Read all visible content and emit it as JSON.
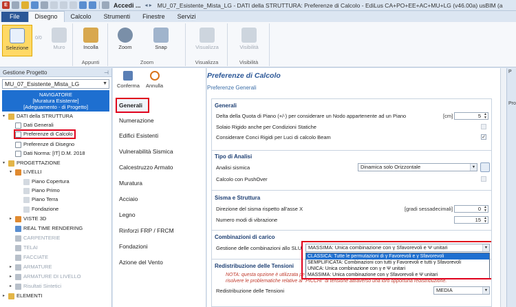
{
  "titlebar": {
    "accedi": "Accedi ...",
    "title": "MU_07_Esistente_Mista_LG  -  DATI della STRUTTURA: Preferenze di Calcolo - EdiLus CA+PO+EE+AC+MU+LG (v46.00a) usBIM (a"
  },
  "ribbon": {
    "tabs": [
      "File",
      "Disegno",
      "Calcolo",
      "Strumenti",
      "Finestre",
      "Servizi"
    ],
    "groups": {
      "selezione": "Selezione",
      "muro": "Muro",
      "counter": "0/0",
      "incolla": "Incolla",
      "appunti": "Appunti",
      "zoom1": "Zoom",
      "zoom2": "Zoom",
      "snap": "Snap",
      "visualizza1": "Visualizza",
      "visualizza2": "Visualizza",
      "visibilita1": "Visibilità",
      "visibilita2": "Visibilità"
    }
  },
  "project": {
    "header": "Gestione Progetto",
    "selected": "MU_07_Esistente_Mista_LG",
    "navigator": [
      "NAVIGATORE",
      "[Muratura Esistente]",
      "[Adeguamento - di Progetto]"
    ],
    "tree": [
      {
        "label": "DATI della STRUTTURA"
      },
      {
        "label": "Dati Generali"
      },
      {
        "label": "Preferenze di Calcolo"
      },
      {
        "label": "Preferenze di Disegno"
      },
      {
        "label": "Dati Norma: [IT] D.M. 2018"
      },
      {
        "label": "PROGETTAZIONE"
      },
      {
        "label": "LIVELLI"
      },
      {
        "label": "Piano Copertura"
      },
      {
        "label": "Piano Primo"
      },
      {
        "label": "Piano Terra"
      },
      {
        "label": "Fondazione"
      },
      {
        "label": "VISTE 3D"
      },
      {
        "label": "REAL TIME RENDERING"
      },
      {
        "label": "CARPENTERIE"
      },
      {
        "label": "TELAI"
      },
      {
        "label": "FACCIATE"
      },
      {
        "label": "ARMATURE"
      },
      {
        "label": "ARMATURE DI LIVELLO"
      },
      {
        "label": "Risultati Sintetici"
      },
      {
        "label": "ELEMENTI"
      }
    ]
  },
  "categories": {
    "conferma": "Conferma",
    "annulla": "Annulla",
    "items": [
      "Generali",
      "Numerazione",
      "Edifici Esistenti",
      "Vulnerabilità Sismica",
      "Calcestruzzo Armato",
      "Muratura",
      "Acciaio",
      "Legno",
      "Rinforzi FRP / FRCM",
      "Fondazioni",
      "Azione del Vento"
    ]
  },
  "main": {
    "title": "Preferenze di Calcolo",
    "subtitle": "Preferenze Generali",
    "generali": {
      "title": "Generali",
      "delta_label": "Delta della Quota di Piano (+/-) per considerare un Nodo appartenente ad un Piano",
      "delta_unit": "[cm]",
      "delta_value": "5",
      "solaio_label": "Solaio Rigido anche per Condizioni Statiche",
      "conci_label": "Considerare Conci Rigidi per Luci di calcolo Beam",
      "conci_check": "✓"
    },
    "analisi": {
      "title": "Tipo di Analisi",
      "sismica_label": "Analisi sismica",
      "sismica_value": "Dinamica solo Orizzontale",
      "pushover_label": "Calcolo con PushOver"
    },
    "sisma": {
      "title": "Sisma e Struttura",
      "direzione_label": "Direzione del sisma rispetto all'asse X",
      "direzione_unit": "[gradi sessadecimali]",
      "direzione_value": "0",
      "modi_label": "Numero modi di vibrazione",
      "modi_value": "15"
    },
    "combinazioni": {
      "title": "Combinazioni di carico",
      "gestione_label": "Gestione delle combinazioni allo SLU",
      "gestione_value": "MASSIMA: Unica combinazione con γ Sfavorevoli e Ψ unitari",
      "options": [
        "CLASSICA: Tutte le permutazioni di γ Favorevoli e γ Sfavorevoli",
        "SEMPLIFICATA: Combinazioni con tutti γ Favorevoli e tutti γ Sfavorevoli",
        "UNICA: Unica combinazione con γ e Ψ unitari",
        "MASSIMA: Unica combinazione con γ Sfavorevoli e Ψ unitari"
      ]
    },
    "redistribuzione": {
      "title": "Redistribuzione delle Tensioni",
      "note_1": "NOTA: questa opzione è utilizzata pe",
      "note_2": "risolvere le problematiche relative al \"PICCHI\" di tensione attraverso una loro opportuna redistribuzione.",
      "label": "Redistribuzione delle Tensioni",
      "value": "MEDIA"
    }
  },
  "right_panel": {
    "head": "P",
    "tab": "Pro"
  }
}
